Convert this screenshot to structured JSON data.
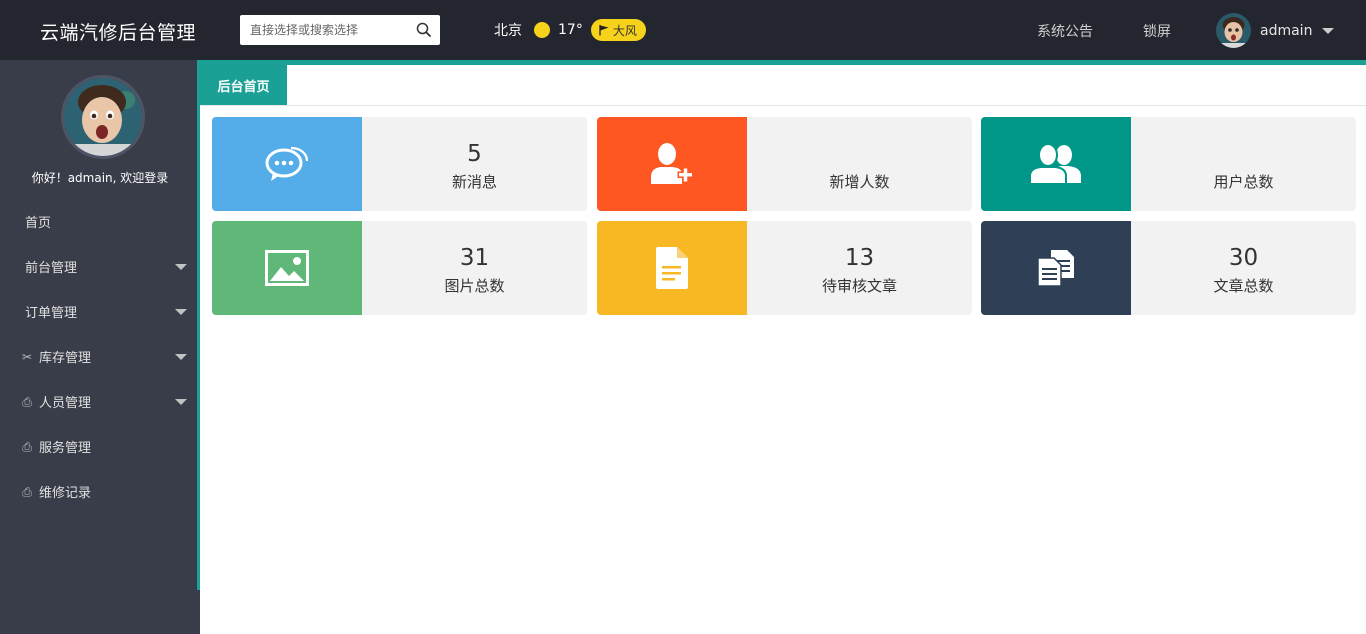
{
  "header": {
    "logo": "云端汽修后台管理",
    "search_placeholder": "直接选择或搜索选择",
    "weather": {
      "city": "北京",
      "temp": "17°",
      "wind": "大风",
      "sun_color": "#f7d21b"
    },
    "links": {
      "notice": "系统公告",
      "lock": "锁屏"
    },
    "user": "admain"
  },
  "sidebar": {
    "welcome": "你好！admain, 欢迎登录",
    "items": [
      {
        "label": "首页"
      },
      {
        "label": "前台管理"
      },
      {
        "label": "订单管理"
      },
      {
        "label": "库存管理"
      },
      {
        "label": "人员管理"
      },
      {
        "label": "服务管理"
      },
      {
        "label": "维修记录"
      }
    ]
  },
  "tabs": {
    "home": "后台首页"
  },
  "cards": [
    {
      "value": "5",
      "label": "新消息",
      "color": "#54ade8",
      "icon": "chat-icon"
    },
    {
      "value": "",
      "label": "新增人数",
      "color": "#ff5722",
      "icon": "add-user-icon"
    },
    {
      "value": "",
      "label": "用户总数",
      "color": "#009688",
      "icon": "users-icon"
    },
    {
      "value": "31",
      "label": "图片总数",
      "color": "#5fb878",
      "icon": "image-icon"
    },
    {
      "value": "13",
      "label": "待审核文章",
      "color": "#f7b824",
      "icon": "document-icon"
    },
    {
      "value": "30",
      "label": "文章总数",
      "color": "#2f4056",
      "icon": "documents-icon"
    }
  ],
  "colors": {
    "header_bg": "#23262e",
    "sidebar_bg": "#393d49",
    "accent": "#1aa094"
  }
}
